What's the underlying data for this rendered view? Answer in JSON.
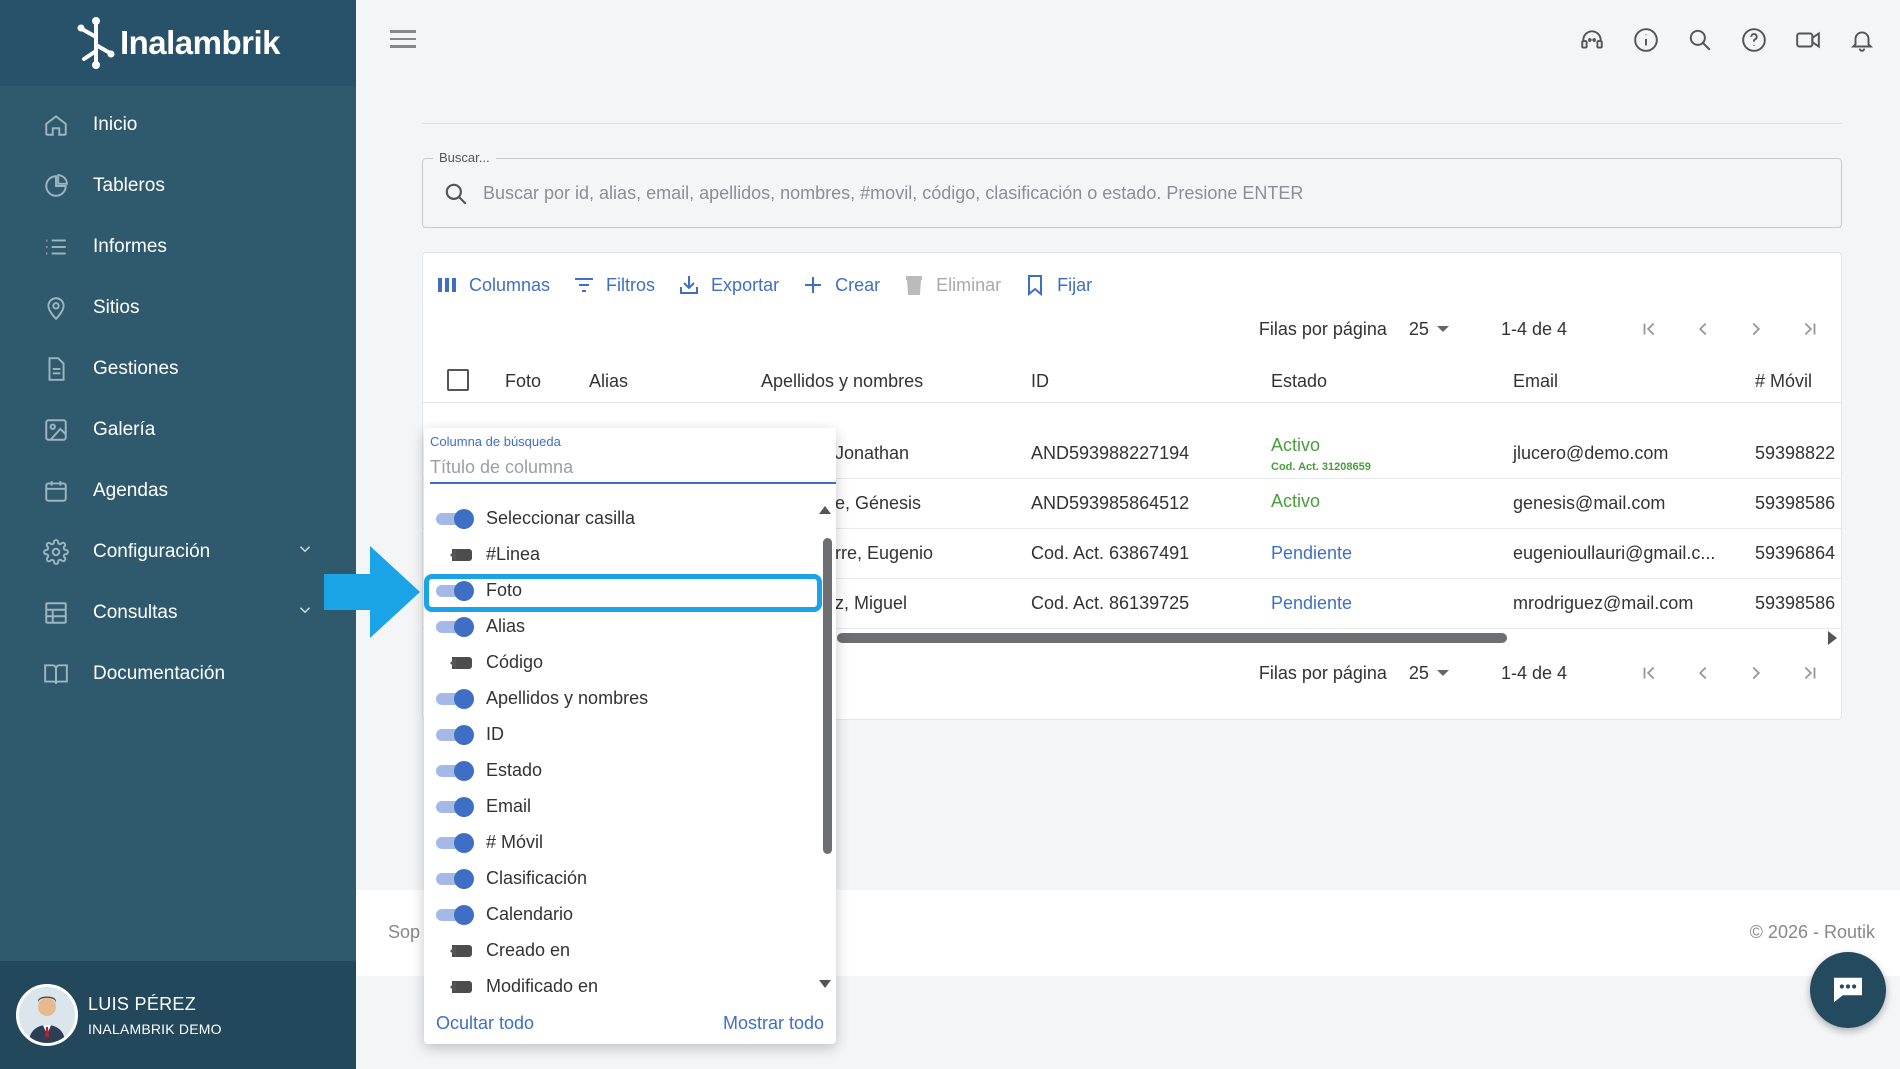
{
  "brand": {
    "name": "Inalambrik"
  },
  "sidebar": {
    "items": [
      {
        "label": "Inicio",
        "icon": "home-icon"
      },
      {
        "label": "Tableros",
        "icon": "pie-chart-icon"
      },
      {
        "label": "Informes",
        "icon": "list-icon"
      },
      {
        "label": "Sitios",
        "icon": "location-pin-icon"
      },
      {
        "label": "Gestiones",
        "icon": "document-icon"
      },
      {
        "label": "Galería",
        "icon": "image-icon"
      },
      {
        "label": "Agendas",
        "icon": "calendar-icon"
      },
      {
        "label": "Configuración",
        "icon": "gear-icon"
      },
      {
        "label": "Consultas",
        "icon": "table-icon"
      },
      {
        "label": "Documentación",
        "icon": "book-icon"
      }
    ],
    "user": {
      "name": "LUIS PÉREZ",
      "org": "INALAMBRIK DEMO"
    }
  },
  "search": {
    "legend": "Buscar...",
    "placeholder": "Buscar por id, alias, email, apellidos, nombres, #movil, código, clasificación o estado. Presione ENTER"
  },
  "toolbar": {
    "columns": "Columnas",
    "filters": "Filtros",
    "export": "Exportar",
    "create": "Crear",
    "delete": "Eliminar",
    "pin": "Fijar"
  },
  "pagination": {
    "rows_per_page_label": "Filas por página",
    "rows_per_page": "25",
    "range": "1-4 de 4"
  },
  "table": {
    "headers": {
      "foto": "Foto",
      "alias": "Alias",
      "nombres": "Apellidos y nombres",
      "id": "ID",
      "estado": "Estado",
      "email": "Email",
      "movil": "# Móvil"
    },
    "rows": [
      {
        "nombres": "Jonathan",
        "id": "AND593988227194",
        "estado": "Activo",
        "estado_sub": "Cod. Act. 31208659",
        "email": "jlucero@demo.com",
        "movil": "59398822"
      },
      {
        "nombres": "e, Génesis",
        "id": "AND593985864512",
        "estado": "Activo",
        "estado_sub": "",
        "email": "genesis@mail.com",
        "movil": "59398586"
      },
      {
        "nombres": "rre, Eugenio",
        "id": "Cod. Act. 63867491",
        "estado": "Pendiente",
        "estado_sub": "",
        "email": "eugenioullauri@gmail.c...",
        "movil": "59396864"
      },
      {
        "nombres": "z, Miguel",
        "id": "Cod. Act. 86139725",
        "estado": "Pendiente",
        "estado_sub": "",
        "email": "mrodriguez@mail.com",
        "movil": "59398586"
      }
    ]
  },
  "columns_panel": {
    "label": "Columna de búsqueda",
    "placeholder": "Título de columna",
    "items": [
      {
        "label": "Seleccionar casilla",
        "on": true
      },
      {
        "label": "#Linea",
        "on": false
      },
      {
        "label": "Foto",
        "on": true
      },
      {
        "label": "Alias",
        "on": true
      },
      {
        "label": "Código",
        "on": false
      },
      {
        "label": "Apellidos y nombres",
        "on": true
      },
      {
        "label": "ID",
        "on": true
      },
      {
        "label": "Estado",
        "on": true
      },
      {
        "label": "Email",
        "on": true
      },
      {
        "label": "# Móvil",
        "on": true
      },
      {
        "label": "Clasificación",
        "on": true
      },
      {
        "label": "Calendario",
        "on": true
      },
      {
        "label": "Creado en",
        "on": false
      },
      {
        "label": "Modificado en",
        "on": false
      }
    ],
    "hide_all": "Ocultar todo",
    "show_all": "Mostrar todo"
  },
  "footer": {
    "left": "Sop",
    "copyright": "© 2026 - Routik"
  },
  "colors": {
    "primary": "#3f6fc4",
    "sidebar": "#2f5a6e",
    "active": "#4a9d3e",
    "highlight": "#1aa3e6"
  }
}
